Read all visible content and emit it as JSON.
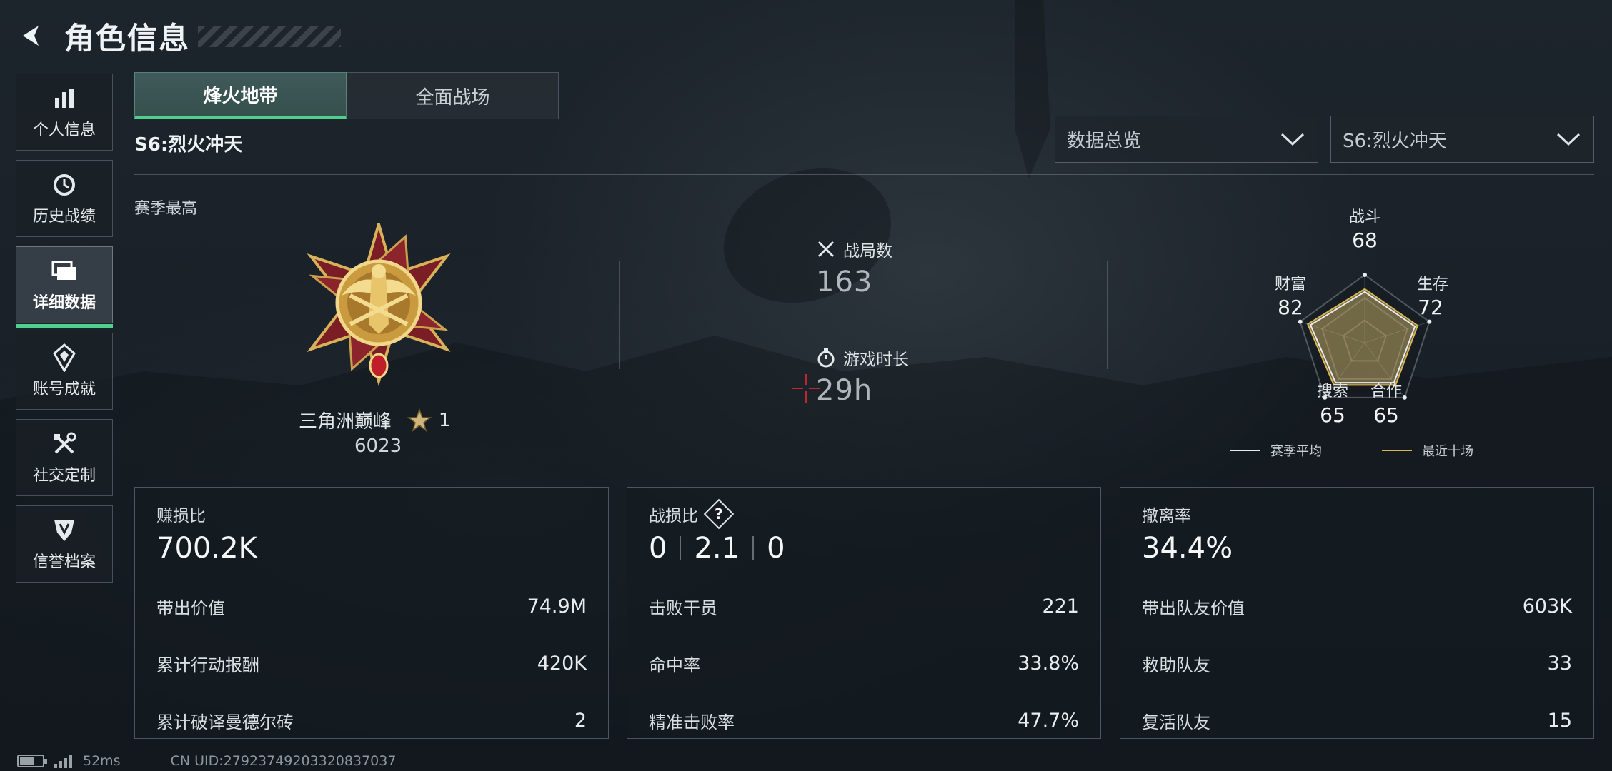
{
  "header": {
    "title": "角色信息"
  },
  "sidebar": {
    "items": [
      {
        "label": "个人信息",
        "icon": "bar-chart-icon",
        "active": false
      },
      {
        "label": "历史战绩",
        "icon": "history-icon",
        "active": false
      },
      {
        "label": "详细数据",
        "icon": "stacked-cards-icon",
        "active": true
      },
      {
        "label": "账号成就",
        "icon": "achievement-icon",
        "active": false
      },
      {
        "label": "社交定制",
        "icon": "tools-icon",
        "active": false
      },
      {
        "label": "信誉档案",
        "icon": "shield-badge-icon",
        "active": false
      }
    ]
  },
  "tabs": [
    {
      "label": "烽火地带",
      "active": true
    },
    {
      "label": "全面战场",
      "active": false
    }
  ],
  "season_label": "S6:烈火冲天",
  "filters": {
    "view": "数据总览",
    "season": "S6:烈火冲天"
  },
  "season_high": {
    "heading": "赛季最高",
    "rank_name": "三角洲巅峰",
    "stars": "1",
    "points": "6023"
  },
  "stats": {
    "matches_label": "战局数",
    "matches_value": "163",
    "playtime_label": "游戏时长",
    "playtime_value": "29h"
  },
  "radar": {
    "axes": [
      {
        "label": "战斗",
        "value": "68"
      },
      {
        "label": "生存",
        "value": "72"
      },
      {
        "label": "合作",
        "value": "65"
      },
      {
        "label": "搜索",
        "value": "65"
      },
      {
        "label": "财富",
        "value": "82"
      }
    ],
    "legend": [
      {
        "label": "赛季平均",
        "color": "#e8ecee"
      },
      {
        "label": "最近十场",
        "color": "#d9b552"
      }
    ]
  },
  "cards": {
    "profit": {
      "title": "赚损比",
      "value": "700.2K",
      "rows": [
        {
          "label": "带出价值",
          "value": "74.9M"
        },
        {
          "label": "累计行动报酬",
          "value": "420K"
        },
        {
          "label": "累计破译曼德尔砖",
          "value": "2"
        }
      ]
    },
    "combat": {
      "title": "战损比",
      "kd": [
        "0",
        "2.1",
        "0"
      ],
      "rows": [
        {
          "label": "击败干员",
          "value": "221"
        },
        {
          "label": "命中率",
          "value": "33.8%"
        },
        {
          "label": "精准击败率",
          "value": "47.7%"
        }
      ]
    },
    "extract": {
      "title": "撤离率",
      "value": "34.4%",
      "rows": [
        {
          "label": "带出队友价值",
          "value": "603K"
        },
        {
          "label": "救助队友",
          "value": "33"
        },
        {
          "label": "复活队友",
          "value": "15"
        }
      ]
    }
  },
  "footer": {
    "ping": "52ms",
    "uid": "CN UID:27923749203320837037"
  }
}
